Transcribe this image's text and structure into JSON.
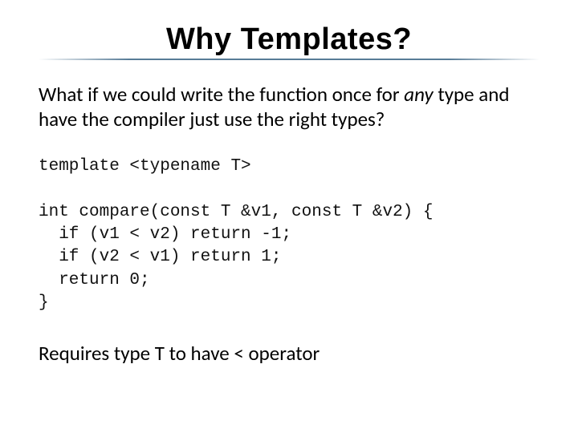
{
  "title": "Why Templates?",
  "intro": {
    "pre": "What if we could write the function once for ",
    "em": "any",
    "post": " type and have the compiler just use the right types?"
  },
  "code": "template <typename T>\n\nint compare(const T &v1, const T &v2) {\n  if (v1 < v2) return -1;\n  if (v2 < v1) return 1;\n  return 0;\n}",
  "footer": "Requires type T to have < operator"
}
